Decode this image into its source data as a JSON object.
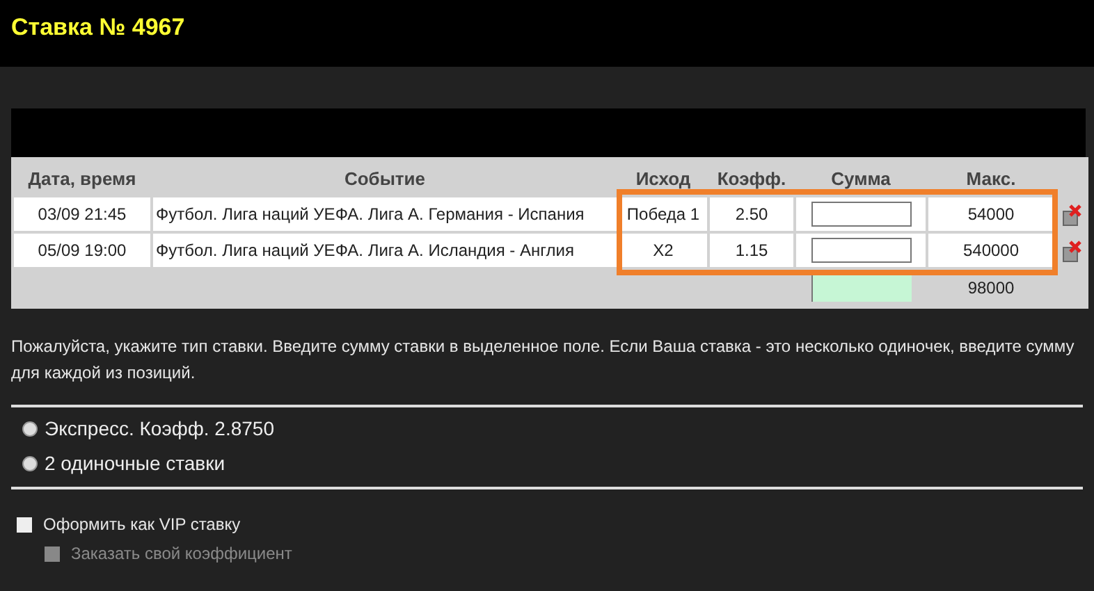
{
  "title": "Ставка № 4967",
  "table": {
    "columns": [
      "Дата, время",
      "Событие",
      "Исход",
      "Коэфф.",
      "Сумма",
      "Макс."
    ],
    "rows": [
      {
        "datetime": "03/09 21:45",
        "event": "Футбол. Лига наций УЕФА. Лига А. Германия - Испания",
        "outcome": "Победа 1",
        "coeff": "2.50",
        "max": "54000"
      },
      {
        "datetime": "05/09 19:00",
        "event": "Футбол. Лига наций УЕФА. Лига А. Исландия - Англия",
        "outcome": "X2",
        "coeff": "1.15",
        "max": "540000"
      }
    ],
    "total_max": "98000"
  },
  "instructions": "Пожалуйста, укажите тип ставки. Введите сумму ставки в выделенное поле. Если Ваша ставка - это несколько одиночек, введите сумму для каждой из позиций.",
  "bet_types": [
    {
      "label": "Экспресс. Коэфф. 2.8750",
      "selected": false
    },
    {
      "label": "2 одиночные ставки",
      "selected": false
    }
  ],
  "options": [
    {
      "label": "Оформить как VIP ставку",
      "checked": false,
      "disabled": false,
      "nested": false
    },
    {
      "label": "Заказать свой коэффициент",
      "checked": false,
      "disabled": true,
      "nested": true
    }
  ]
}
